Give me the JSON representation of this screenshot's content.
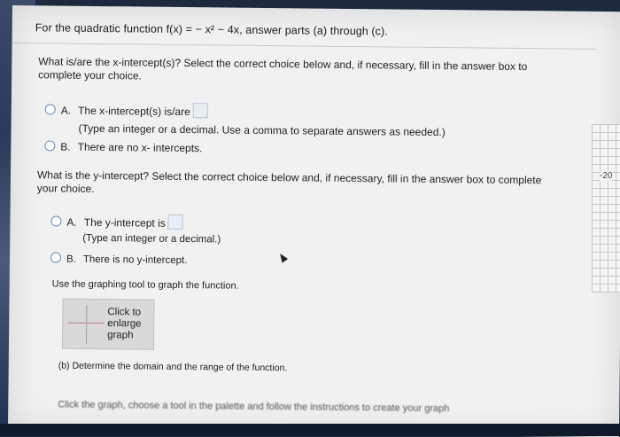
{
  "header": {
    "title": "For the quadratic function f(x) = − x² − 4x, answer parts (a) through (c)."
  },
  "x_intercept": {
    "question": "What is/are the x-intercept(s)? Select the correct choice below and, if necessary, fill in the answer box to complete your choice.",
    "option_a_letter": "A.",
    "option_a_text": "The x-intercept(s) is/are",
    "option_a_hint": "(Type an integer or a decimal. Use a comma to separate answers as needed.)",
    "option_b_letter": "B.",
    "option_b_text": "There are no x- intercepts."
  },
  "y_intercept": {
    "question": "What is the y-intercept? Select the correct choice below and, if necessary, fill in the answer box to complete your choice.",
    "option_a_letter": "A.",
    "option_a_text": "The y-intercept is",
    "option_a_hint": "(Type an integer or a decimal.)",
    "option_b_letter": "B.",
    "option_b_text": "There is no y-intercept."
  },
  "graph": {
    "instruction": "Use the graphing tool to graph the function.",
    "button_label_1": "Click to",
    "button_label_2": "enlarge",
    "button_label_3": "graph",
    "side_axis_label": "-20"
  },
  "part_b": {
    "question": "(b) Determine the domain and the range of the function."
  },
  "footer": {
    "instruction": "Click the graph, choose a tool in the palette and follow the instructions to create your graph"
  }
}
